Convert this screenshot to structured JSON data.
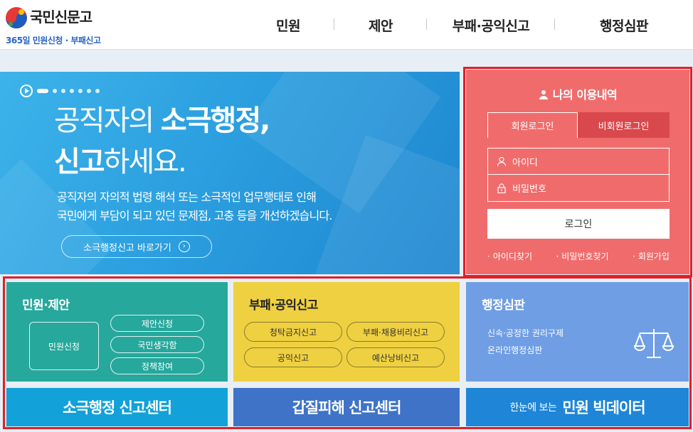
{
  "header": {
    "logo_title": "국민신문고",
    "logo_sub": "365일 민원신청 · 부패신고",
    "nav": [
      "민원",
      "제안",
      "부패·공익신고",
      "행정심판"
    ]
  },
  "hero": {
    "line1_normal": "공직자의 ",
    "line1_bold": "소극행정,",
    "line2_bold": "신고",
    "line2_normal": "하세요.",
    "desc1": "공직자의 자의적 법령 해석 또는 소극적인 업무행태로 인해",
    "desc2": "국민에게 부담이 되고 있던 문제점, 고충 등을 개선하겠습니다.",
    "button": "소극행정신고 바로가기",
    "slide_dots": 7
  },
  "login": {
    "title": "나의 이용내역",
    "tab_member": "회원로그인",
    "tab_nonmember": "비회원로그인",
    "id_placeholder": "아이디",
    "pw_placeholder": "비밀번호",
    "login_button": "로그인",
    "links": [
      "아이디찾기",
      "비밀번호찾기",
      "회원가입"
    ]
  },
  "panels": {
    "civil": {
      "title": "민원·제안",
      "main_button": "민원신청",
      "buttons": [
        "제안신청",
        "국민생각함",
        "정책참여"
      ]
    },
    "report": {
      "title": "부패·공익신고",
      "buttons": [
        "청탁금지신고",
        "부패·채용비리신고",
        "공익신고",
        "예산낭비신고"
      ]
    },
    "trial": {
      "title": "행정심판",
      "line1": "신속·공정한 권리구제",
      "line2": "온라인행정심판"
    }
  },
  "banners": {
    "b1": "소극행정 신고센터",
    "b2": "갑질피해 신고센터",
    "b3_small": "한눈에 보는",
    "b3_big": "민원 빅데이터"
  },
  "colors": {
    "hero_blue": "#2b9fdf",
    "login_red": "#f06c6c",
    "highlight_outline": "#e21e27",
    "panel_teal": "#26a89c",
    "panel_yellow": "#efd040",
    "panel_blue": "#6f9ee4"
  }
}
